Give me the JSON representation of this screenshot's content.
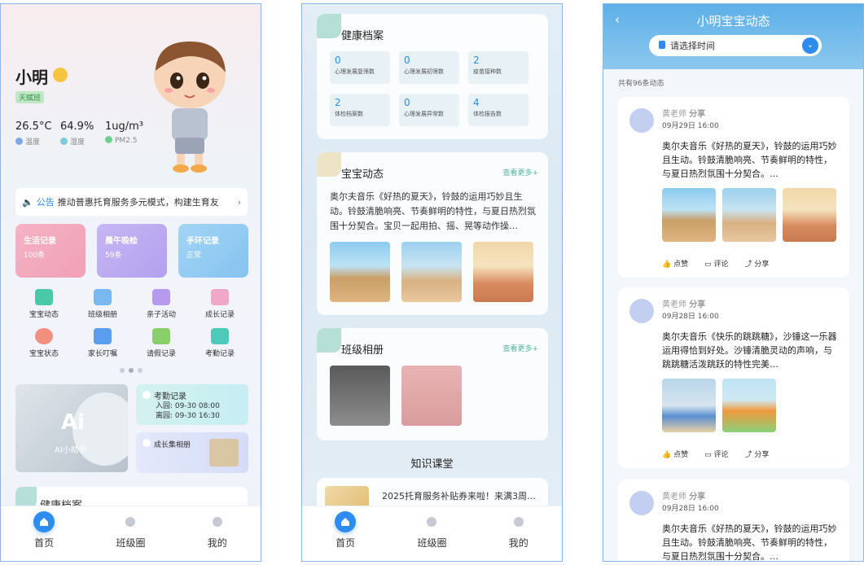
{
  "home": {
    "name": "小明",
    "badge": "天赋班",
    "env": [
      {
        "value": "26.5°C",
        "label": "温度",
        "color": "#7aa8e8"
      },
      {
        "value": "64.9%",
        "label": "湿度",
        "color": "#7ccbd6"
      },
      {
        "value": "1ug/m³",
        "label": "PM2.5",
        "color": "#6dd092"
      }
    ],
    "notice_label": "公告",
    "notice_text": "推动普惠托育服务多元模式，构建生育友",
    "tiles": [
      {
        "title": "生活记录",
        "value": "100条",
        "color": "#f2a3b8"
      },
      {
        "title": "晨午晚检",
        "value": "59条",
        "color": "#b9a6ef"
      },
      {
        "title": "手环记录",
        "value": "正常",
        "color": "#8ec9f1"
      }
    ],
    "grid": [
      {
        "label": "宝宝动态",
        "icon": "star-icon",
        "color": "#49c9a8"
      },
      {
        "label": "班级相册",
        "icon": "photo-icon",
        "color": "#7ab8f0"
      },
      {
        "label": "亲子活动",
        "icon": "people-icon",
        "color": "#b79af0"
      },
      {
        "label": "成长记录",
        "icon": "book-icon",
        "color": "#f0a8c8"
      },
      {
        "label": "宝宝状态",
        "icon": "face-icon",
        "color": "#f29080"
      },
      {
        "label": "家长叮嘱",
        "icon": "bell-icon",
        "color": "#5a9ef0"
      },
      {
        "label": "请假记录",
        "icon": "person-icon",
        "color": "#8ad06a"
      },
      {
        "label": "考勤记录",
        "icon": "calendar-check-icon",
        "color": "#4fc9b9"
      }
    ],
    "ai_title": "Ai",
    "ai_label": "AI小助手",
    "attendance_title": "考勤记录",
    "attendance_in": "入园: 09-30 08:00",
    "attendance_out": "离园: 09-30 16:30",
    "growth_title": "成长集相册",
    "health_title": "健康档案"
  },
  "nav": [
    {
      "label": "首页",
      "icon": "home-icon"
    },
    {
      "label": "班级圈",
      "icon": "circle-icon"
    },
    {
      "label": "我的",
      "icon": "user-icon"
    }
  ],
  "detail": {
    "health_title": "健康档案",
    "health_items": [
      {
        "value": "0",
        "label": "心理发展复筛数"
      },
      {
        "value": "0",
        "label": "心理发展初筛数"
      },
      {
        "value": "2",
        "label": "疫苗接种数"
      },
      {
        "value": "2",
        "label": "体检档案数"
      },
      {
        "value": "0",
        "label": "心理发展异常数"
      },
      {
        "value": "4",
        "label": "体检报告数"
      }
    ],
    "dynamics_title": "宝宝动态",
    "dynamics_more": "查看更多+",
    "dynamics_text": "奥尔夫音乐《好热的夏天》，铃鼓的运用巧妙且生动。铃鼓清脆响亮、节奏鲜明的特性，与夏日热烈氛围十分契合。宝贝一起用拍、摇、晃等动作操…",
    "album_title": "班级相册",
    "album_more": "查看更多+",
    "knowledge_title": "知识课堂",
    "knowledge_item": "2025托育服务补贴券来啦！来满3周…"
  },
  "feed": {
    "title": "小明宝宝动态",
    "back": "‹",
    "select_placeholder": "请选择时间",
    "count": "共有96条动态",
    "posts": [
      {
        "author": "黄老师",
        "action": "分享",
        "date": "09月29日  16:00",
        "text": "奥尔夫音乐《好热的夏天》，铃鼓的运用巧妙且生动。铃鼓清脆响亮、节奏鲜明的特性，与夏日热烈氛围十分契合。…",
        "photos": 3
      },
      {
        "author": "黄老师",
        "action": "分享",
        "date": "09月28日  16:00",
        "text": "奥尔夫音乐《快乐的跳跳糖》，沙锤这一乐器运用得恰到好处。沙锤清脆灵动的声响，与跳跳糖活泼跳跃的特性完美…",
        "photos": 2
      },
      {
        "author": "黄老师",
        "action": "分享",
        "date": "09月28日  16:00",
        "text": "奥尔夫音乐《好热的夏天》，铃鼓的运用巧妙且生动。铃鼓清脆响亮、节奏鲜明的特性，与夏日热烈氛围十分契合。…",
        "photos": 0
      }
    ],
    "like": "点赞",
    "comment": "评论",
    "share": "分享"
  }
}
